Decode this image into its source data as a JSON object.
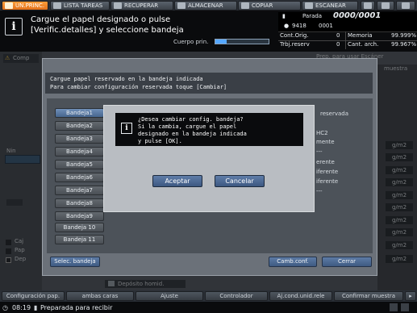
{
  "tabs": [
    {
      "label": "UN.PRINC."
    },
    {
      "label": "LISTA TAREAS"
    },
    {
      "label": "RECUPERAR"
    },
    {
      "label": "ALMACENAR"
    },
    {
      "label": "COPIAR"
    },
    {
      "label": "ESCANEAR"
    }
  ],
  "header": {
    "message_line1": "Cargue el papel designado o pulse",
    "message_line2": "[Verific.detalles] y seleccione bandeja",
    "cuerpo_label": "Cuerpo prin.",
    "state": "Parada",
    "counter": "0000/0001",
    "user_id": "9418",
    "user_count": "0001",
    "rows": [
      {
        "label": "Cont.Orig.",
        "value": "0",
        "label2": "Memoria",
        "value2": "99.999%"
      },
      {
        "label": "Trbj.reserv",
        "value": "0",
        "label2": "Cant. arch.",
        "value2": "99.967%"
      }
    ]
  },
  "background": {
    "left_tab": "Comp",
    "left_label": "Nin",
    "right_top": "Prep. para usar Escáner",
    "right_top2": "muestra",
    "right_items": [
      "g/m2",
      "g/m2",
      "g/m2",
      "g/m2",
      "g/m2",
      "g/m2",
      "g/m2",
      "g/m2",
      "g/m2",
      "g/m2"
    ],
    "bottom_label": "Depósito homid.",
    "side_items": [
      "Caj",
      "Pap",
      "Dep"
    ]
  },
  "dialog": {
    "line1": "Cargue papel reservado en la bandeja indicada",
    "line2": "Para cambiar configuración reservada toque [Cambiar]",
    "trays": [
      "Bandeja1",
      "Bandeja2",
      "Bandeja3",
      "Bandeja4",
      "Bandeja5",
      "Bandeja6",
      "Bandeja7",
      "Bandeja8",
      "Bandeja9",
      "Bandeja 10",
      "Bandeja 11"
    ],
    "right_header": "reservada",
    "right_rows": [
      "HC2",
      "mente",
      "---",
      "erente",
      "iferente",
      "iferente",
      "---"
    ],
    "btn_select_tray": "Selec. bandeja",
    "btn_change_config": "Camb.conf.",
    "btn_close": "Cerrar"
  },
  "confirm": {
    "line1": "¿Desea cambiar config. bandeja?",
    "line2": "Si la cambia, cargue el papel",
    "line3": "designado en la bandeja indicada",
    "line4": "y pulse [OK].",
    "accept": "Aceptar",
    "cancel": "Cancelar"
  },
  "bottom_tabs": [
    {
      "label": "Configuración pap."
    },
    {
      "label": "ambas caras"
    },
    {
      "label": "Ajuste"
    },
    {
      "label": "Controlador"
    },
    {
      "label": "Aj.cond.unid.rele"
    },
    {
      "label": "Confirmar muestra"
    }
  ],
  "status": {
    "time": "08:19",
    "text": "Preparada para recibir"
  }
}
